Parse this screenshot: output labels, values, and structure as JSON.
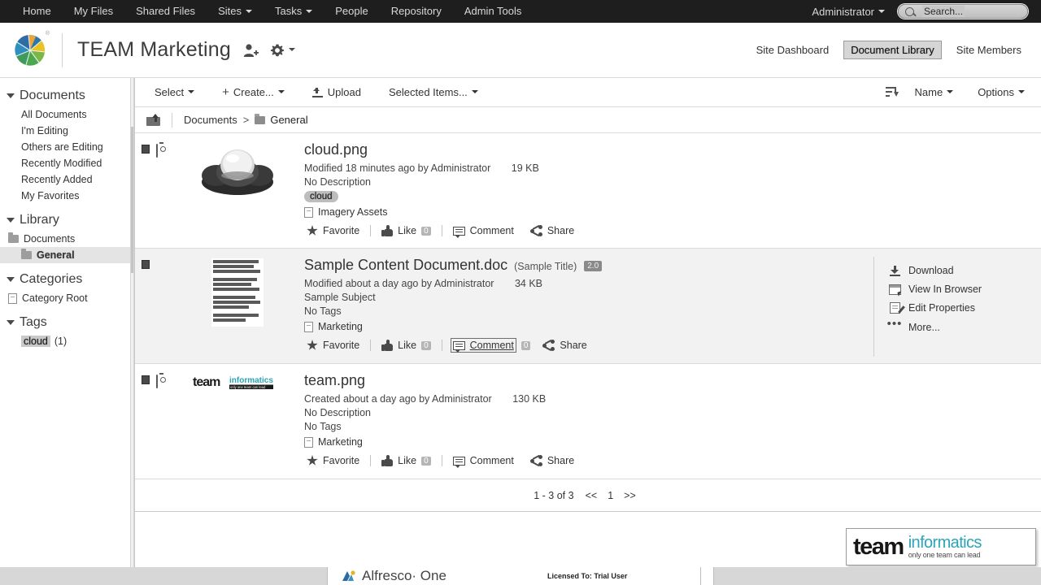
{
  "topnav": {
    "items": [
      {
        "label": "Home",
        "dropdown": false
      },
      {
        "label": "My Files",
        "dropdown": false
      },
      {
        "label": "Shared Files",
        "dropdown": false
      },
      {
        "label": "Sites",
        "dropdown": true
      },
      {
        "label": "Tasks",
        "dropdown": true
      },
      {
        "label": "People",
        "dropdown": false
      },
      {
        "label": "Repository",
        "dropdown": false
      },
      {
        "label": "Admin Tools",
        "dropdown": false
      }
    ],
    "user": "Administrator",
    "search_placeholder": "Search...",
    "search_value": "Search..."
  },
  "siteheader": {
    "title": "TEAM Marketing",
    "logo_registered": "®",
    "invite_icon": "add-user-icon",
    "settings_icon": "gear-icon",
    "links": [
      {
        "label": "Site Dashboard",
        "active": false
      },
      {
        "label": "Document Library",
        "active": true
      },
      {
        "label": "Site Members",
        "active": false
      }
    ]
  },
  "sidebar": {
    "groups": [
      {
        "title": "Documents",
        "items": [
          {
            "label": "All Documents",
            "selected": false
          },
          {
            "label": "I'm Editing",
            "selected": false
          },
          {
            "label": "Others are Editing",
            "selected": false
          },
          {
            "label": "Recently Modified",
            "selected": false
          },
          {
            "label": "Recently Added",
            "selected": false
          },
          {
            "label": "My Favorites",
            "selected": false
          }
        ]
      },
      {
        "title": "Library",
        "folders": [
          {
            "label": "Documents",
            "selected": false,
            "nested": false
          },
          {
            "label": "General",
            "selected": true,
            "nested": true
          }
        ]
      },
      {
        "title": "Categories",
        "categories": [
          {
            "label": "Category Root"
          }
        ]
      },
      {
        "title": "Tags",
        "tags": [
          {
            "label": "cloud",
            "count": "(1)"
          }
        ]
      }
    ]
  },
  "toolbar": {
    "select_label": "Select",
    "create_label": "Create...",
    "upload_label": "Upload",
    "selected_items_label": "Selected Items...",
    "sort_icon": "sort-descending-icon",
    "sort_label": "Name",
    "options_label": "Options"
  },
  "breadcrumb": {
    "up_icon": "folder-up-icon",
    "root": "Documents",
    "separator": ">",
    "current": "General"
  },
  "documents": [
    {
      "name": "cloud.png",
      "subtitle": "",
      "version": "",
      "selected": false,
      "type_icon": "image-icon",
      "thumbnail": "cloud-thumbnail",
      "modified": "Modified 18 minutes ago by Administrator",
      "size": "19 KB",
      "description": "No Description",
      "tags": [
        "cloud"
      ],
      "no_tags_label": "",
      "category": "Imagery Assets",
      "social": {
        "favorite": "Favorite",
        "like": "Like",
        "like_count": "0",
        "comment": "Comment",
        "comment_count": "",
        "share": "Share",
        "comment_focused": false
      },
      "actions": []
    },
    {
      "name": "Sample Content Document.doc",
      "subtitle": "(Sample Title)",
      "version": "2.0",
      "selected": true,
      "type_icon": "",
      "thumbnail": "document-thumbnail",
      "modified": "Modified about a day ago by Administrator",
      "size": "34 KB",
      "description": "Sample Subject",
      "tags": [],
      "no_tags_label": "No Tags",
      "category": "Marketing",
      "social": {
        "favorite": "Favorite",
        "like": "Like",
        "like_count": "0",
        "comment": "Comment",
        "comment_count": "0",
        "share": "Share",
        "comment_focused": true
      },
      "actions": [
        {
          "label": "Download",
          "icon": "download-icon"
        },
        {
          "label": "View In Browser",
          "icon": "browser-icon"
        },
        {
          "label": "Edit Properties",
          "icon": "edit-properties-icon"
        },
        {
          "label": "More...",
          "icon": "ellipsis-icon"
        }
      ]
    },
    {
      "name": "team.png",
      "subtitle": "",
      "version": "",
      "selected": false,
      "type_icon": "image-icon",
      "thumbnail": "team-logo-thumbnail",
      "modified": "Created about a day ago by Administrator",
      "size": "130 KB",
      "description": "No Description",
      "tags": [],
      "no_tags_label": "No Tags",
      "category": "Marketing",
      "social": {
        "favorite": "Favorite",
        "like": "Like",
        "like_count": "0",
        "comment": "Comment",
        "comment_count": "",
        "share": "Share",
        "comment_focused": false
      },
      "actions": []
    }
  ],
  "pagination": {
    "info": "1 - 3 of 3",
    "prev": "<<",
    "page": "1",
    "next": ">>"
  },
  "watermark": {
    "team": "team",
    "informatics": "informatics",
    "tagline": "only one team can lead"
  },
  "bottom_strip": {
    "product": "Alfresco· One",
    "license": "Licensed To: Trial User"
  },
  "colors": {
    "topnav_bg": "#1e1e1e",
    "accent_teal": "#2aa5b8",
    "selected_row": "#f2f2f2",
    "sidebar_selected": "#e4e4e4"
  }
}
